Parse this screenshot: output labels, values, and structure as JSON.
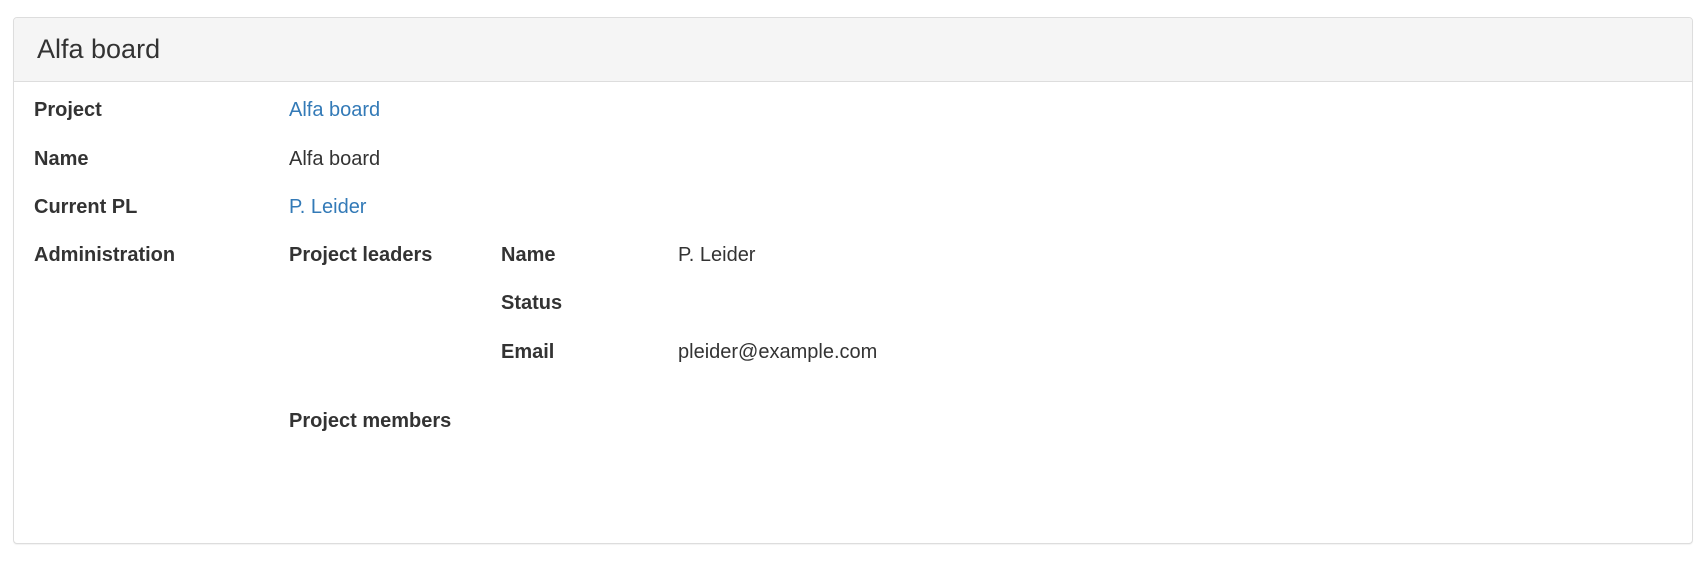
{
  "panel": {
    "title": "Alfa board"
  },
  "details": {
    "project_label": "Project",
    "project_value": "Alfa board",
    "name_label": "Name",
    "name_value": "Alfa board",
    "current_pl_label": "Current PL",
    "current_pl_value": "P. Leider",
    "administration_label": "Administration"
  },
  "administration": {
    "project_leaders_label": "Project leaders",
    "leader": {
      "name_label": "Name",
      "name_value": "P. Leider",
      "status_label": "Status",
      "status_value": "",
      "email_label": "Email",
      "email_value": "pleider@example.com"
    },
    "project_members_label": "Project members"
  },
  "colors": {
    "link": "#337ab7",
    "heading_bg": "#f5f5f5",
    "border": "#dddddd"
  }
}
